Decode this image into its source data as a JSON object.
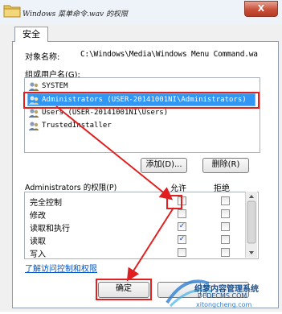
{
  "window": {
    "title": "Windows 菜单命令.wav 的权限",
    "close_label": "X"
  },
  "tabs": [
    {
      "label": "安全"
    }
  ],
  "object": {
    "label": "对象名称:",
    "value": "C:\\Windows\\Media\\Windows Menu Command.wa"
  },
  "groups": {
    "label": "组或用户名(G):",
    "items": [
      {
        "label": "SYSTEM",
        "icon": "users-icon"
      },
      {
        "label": "Administrators (USER-20141001NI\\Administrators)",
        "icon": "users-icon",
        "selected": true
      },
      {
        "label": "Users (USER-20141001NI\\Users)",
        "icon": "users-icon"
      },
      {
        "label": "TrustedInstaller",
        "icon": "users-icon"
      }
    ]
  },
  "buttons": {
    "add": "添加(D)...",
    "remove": "删除(R)",
    "ok": "确定",
    "cancel": "",
    "apply": ""
  },
  "permissions": {
    "title": "Administrators 的权限(P)",
    "allow_header": "允许",
    "deny_header": "拒绝",
    "rows": [
      {
        "name": "完全控制",
        "allow": false,
        "deny": false
      },
      {
        "name": "修改",
        "allow": false,
        "deny": false
      },
      {
        "name": "读取和执行",
        "allow": true,
        "deny": false
      },
      {
        "name": "读取",
        "allow": true,
        "deny": false
      },
      {
        "name": "写入",
        "allow": false,
        "deny": false
      }
    ]
  },
  "advanced_link": "了解访问控制和权限",
  "watermark": {
    "line1": "织梦内容管理系统",
    "line2": "DEDECMS.COM",
    "line3": "xitongcheng.com"
  },
  "colors": {
    "selection": "#3296f5",
    "annotation": "#e02020",
    "link": "#0057c8"
  }
}
